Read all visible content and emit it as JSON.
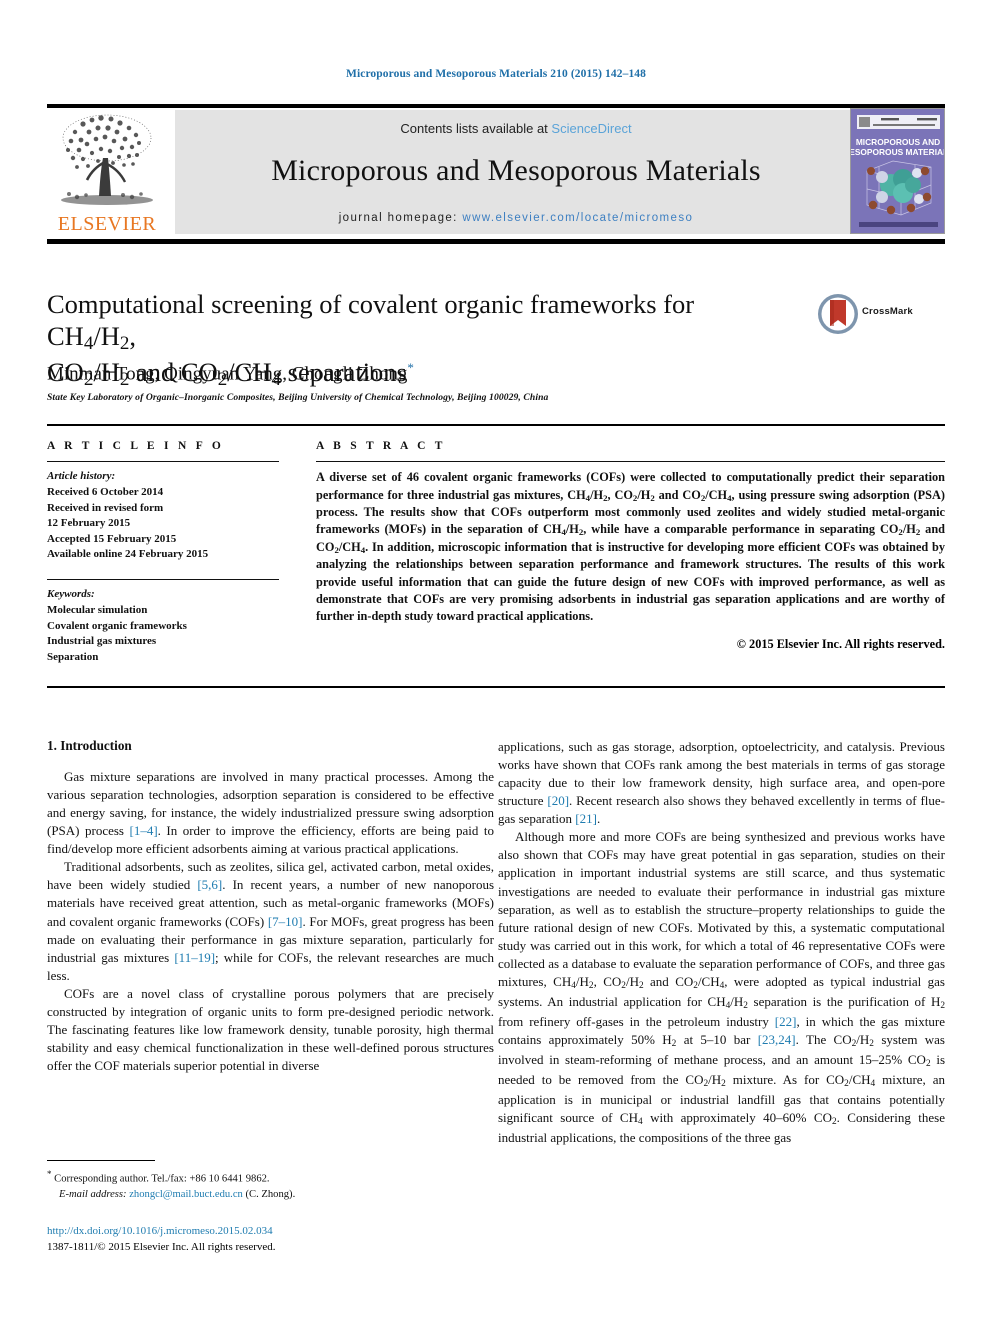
{
  "running_head": "Microporous and Mesoporous Materials 210 (2015) 142–148",
  "masthead": {
    "publisher": "ELSEVIER",
    "contents_prefix": "Contents lists available at ",
    "contents_link": "ScienceDirect",
    "journal_title": "Microporous and Mesoporous Materials",
    "homepage_prefix": "journal homepage: ",
    "homepage_url": "www.elsevier.com/locate/micromeso",
    "cover_line1": "MICROPOROUS AND",
    "cover_line2": "MESOPOROUS MATERIALS"
  },
  "article": {
    "title_line1": "Computational screening of covalent organic frameworks for CH₄/H₂,",
    "title_line2": "CO₂/H₂ and CO₂/CH₄ separations",
    "authors": "Minman Tong, Qingyuan Yang, Chongli Zhong",
    "author_marker": "*",
    "affiliation": "State Key Laboratory of Organic–Inorganic Composites, Beijing University of Chemical Technology, Beijing 100029, China",
    "crossmark_label": "CrossMark"
  },
  "article_info": {
    "heading": "A R T I C L E    I N F O",
    "history_label": "Article history:",
    "history": [
      "Received 6 October 2014",
      "Received in revised form",
      "12 February 2015",
      "Accepted 15 February 2015",
      "Available online 24 February 2015"
    ],
    "keywords_label": "Keywords:",
    "keywords": [
      "Molecular simulation",
      "Covalent organic frameworks",
      "Industrial gas mixtures",
      "Separation"
    ]
  },
  "abstract": {
    "heading": "A B S T R A C T",
    "text": "A diverse set of 46 covalent organic frameworks (COFs) were collected to computationally predict their separation performance for three industrial gas mixtures, CH4/H2, CO2/H2 and CO2/CH4, using pressure swing adsorption (PSA) process. The results show that COFs outperform most commonly used zeolites and widely studied metal-organic frameworks (MOFs) in the separation of CH4/H2, while have a comparable performance in separating CO2/H2 and CO2/CH4. In addition, microscopic information that is instructive for developing more efficient COFs was obtained by analyzing the relationships between separation performance and framework structures. The results of this work provide useful information that can guide the future design of new COFs with improved performance, as well as demonstrate that COFs are very promising adsorbents in industrial gas separation applications and are worthy of further in-depth study toward practical applications.",
    "copyright": "© 2015 Elsevier Inc. All rights reserved."
  },
  "body": {
    "section_heading": "1. Introduction",
    "left_paragraphs": [
      "Gas mixture separations are involved in many practical processes. Among the various separation technologies, adsorption separation is considered to be effective and energy saving, for instance, the widely industrialized pressure swing adsorption (PSA) process [1–4]. In order to improve the efficiency, efforts are being paid to find/develop more efficient adsorbents aiming at various practical applications.",
      "Traditional adsorbents, such as zeolites, silica gel, activated carbon, metal oxides, have been widely studied [5,6]. In recent years, a number of new nanoporous materials have received great attention, such as metal-organic frameworks (MOFs) and covalent organic frameworks (COFs) [7–10]. For MOFs, great progress has been made on evaluating their performance in gas mixture separation, particularly for industrial gas mixtures [11–19]; while for COFs, the relevant researches are much less.",
      "COFs are a novel class of crystalline porous polymers that are precisely constructed by integration of organic units to form pre-designed periodic network. The fascinating features like low framework density, tunable porosity, high thermal stability and easy chemical functionalization in these well-defined porous structures offer the COF materials superior potential in diverse"
    ],
    "right_paragraphs": [
      "applications, such as gas storage, adsorption, optoelectricity, and catalysis. Previous works have shown that COFs rank among the best materials in terms of gas storage capacity due to their low framework density, high surface area, and open-pore structure [20]. Recent research also shows they behaved excellently in terms of flue-gas separation [21].",
      "Although more and more COFs are being synthesized and previous works have also shown that COFs may have great potential in gas separation, studies on their application in important industrial systems are still scarce, and thus systematic investigations are needed to evaluate their performance in industrial gas mixture separation, as well as to establish the structure–property relationships to guide the future rational design of new COFs. Motivated by this, a systematic computational study was carried out in this work, for which a total of 46 representative COFs were collected as a database to evaluate the separation performance of COFs, and three gas mixtures, CH4/H2, CO2/H2 and CO2/CH4, were adopted as typical industrial gas systems. An industrial application for CH4/H2 separation is the purification of H2 from refinery off-gases in the petroleum industry [22], in which the gas mixture contains approximately 50% H2 at 5–10 bar [23,24]. The CO2/H2 system was involved in steam-reforming of methane process, and an amount 15–25% CO2 is needed to be removed from the CO2/H2 mixture. As for CO2/CH4 mixture, an application is in municipal or industrial landfill gas that contains potentially significant source of CH4 with approximately 40–60% CO2. Considering these industrial applications, the compositions of the three gas"
    ]
  },
  "footnote": {
    "marker": "*",
    "corresponding": "Corresponding author. Tel./fax: +86 10 6441 9862.",
    "email_label": "E-mail address:",
    "email": "zhongcl@mail.buct.edu.cn",
    "email_suffix": "(C. Zhong).",
    "doi": "http://dx.doi.org/10.1016/j.micromeso.2015.02.034",
    "issn_line": "1387-1811/© 2015 Elsevier Inc. All rights reserved."
  },
  "colors": {
    "link": "#1f7cb0",
    "running_head": "#1f6fa8",
    "elsevier_orange": "#e87722",
    "masthead_bg": "#e3e3e3",
    "cover_purple": "#7b74b8"
  }
}
